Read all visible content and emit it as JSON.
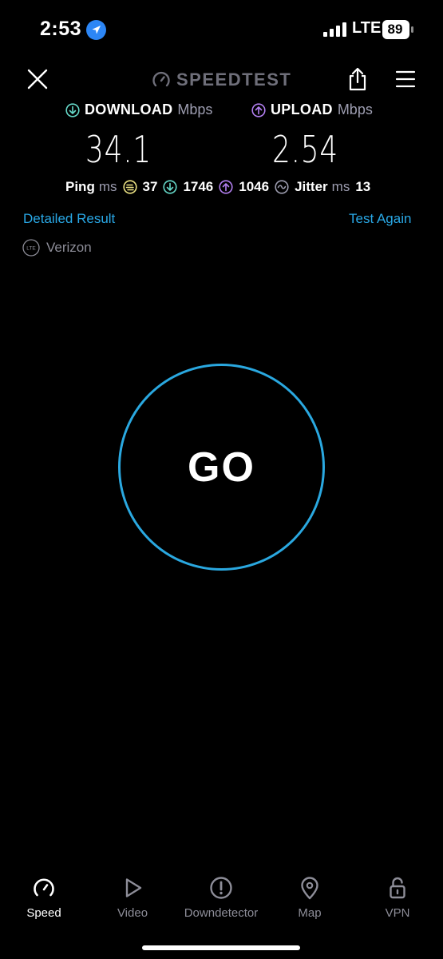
{
  "status_bar": {
    "time": "2:53",
    "network": "LTE",
    "battery": "89",
    "icons": [
      "location-arrow-icon",
      "signal-bars-icon",
      "battery-icon"
    ]
  },
  "header": {
    "title": "SPEEDTEST",
    "icons": [
      "close-icon",
      "speedometer-icon",
      "share-icon",
      "hamburger-menu-icon"
    ]
  },
  "results": {
    "download": {
      "label": "DOWNLOAD",
      "unit": "Mbps",
      "value": "34.1"
    },
    "upload": {
      "label": "UPLOAD",
      "unit": "Mbps",
      "value": "2.54"
    },
    "ping": {
      "label": "Ping",
      "unit": "ms",
      "idle": "37",
      "download": "1746",
      "upload": "1046"
    },
    "jitter": {
      "label": "Jitter",
      "unit": "ms",
      "value": "13"
    }
  },
  "links": {
    "detailed_result": "Detailed Result",
    "test_again": "Test Again"
  },
  "provider": {
    "badge": "LTE",
    "name": "Verizon"
  },
  "go_button": {
    "label": "GO"
  },
  "tabs": [
    {
      "label": "Speed",
      "icon": "speedometer-icon",
      "active": true
    },
    {
      "label": "Video",
      "icon": "play-icon",
      "active": false
    },
    {
      "label": "Downdetector",
      "icon": "alert-icon",
      "active": false
    },
    {
      "label": "Map",
      "icon": "map-pin-icon",
      "active": false
    },
    {
      "label": "VPN",
      "icon": "unlock-icon",
      "active": false
    }
  ],
  "colors": {
    "background": "#000000",
    "accent_blue": "#2aa8e0",
    "download_teal": "#66d9c9",
    "upload_purple": "#b27ff0",
    "ping_yellow": "#ede384",
    "muted_text": "#9d9db0"
  }
}
